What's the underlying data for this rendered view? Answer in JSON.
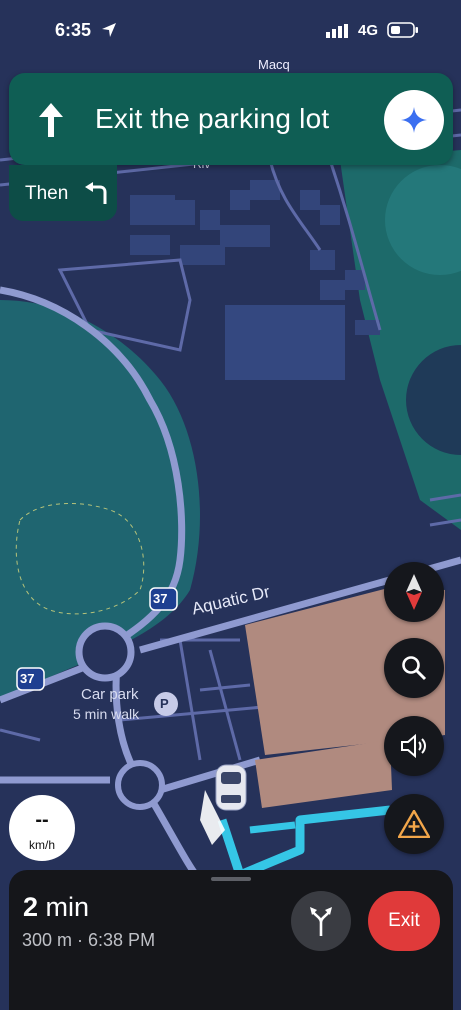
{
  "status_bar": {
    "time": "6:35",
    "network": "4G"
  },
  "navigation": {
    "instruction": "Exit the parking lot",
    "then_label": "Then",
    "maneuver_icon": "arrow-up-icon",
    "then_icon": "turn-left-icon"
  },
  "map": {
    "labels": {
      "street_top": "Macq",
      "street_small": "Riv",
      "aquatic_dr": "Aquatic Dr",
      "road_shield_1": "37",
      "road_shield_2": "37",
      "car_park_line1": "Car park",
      "car_park_line2": "5 min walk",
      "parking_symbol": "P"
    }
  },
  "speed": {
    "value": "--",
    "unit": "km/h"
  },
  "trip": {
    "eta_value": "2",
    "eta_unit": "min",
    "details": "300 m · 6:38 PM",
    "exit_label": "Exit"
  },
  "colors": {
    "banner": "#0f5e54",
    "route": "#35c6e6",
    "exit_button": "#e03a3a",
    "map_background": "#26325a",
    "park": "#1c6a6a",
    "building": "#b08a7f"
  }
}
